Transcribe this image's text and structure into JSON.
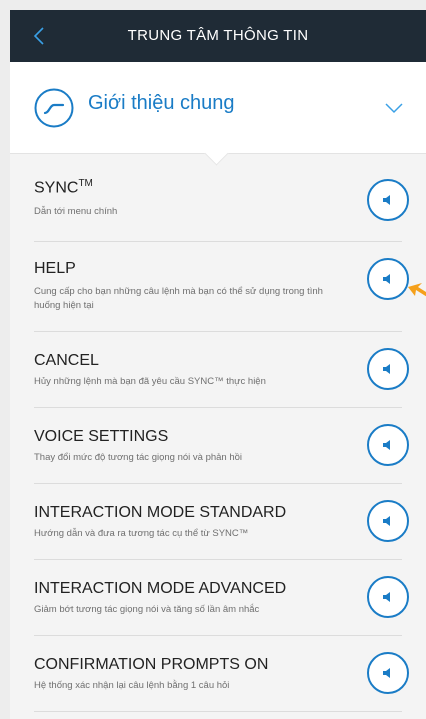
{
  "header": {
    "back_icon": "chevron-left-icon",
    "title": "TRUNG TÂM THÔNG TIN"
  },
  "selector": {
    "icon": "sync-curve-icon",
    "label": "Giới thiệu chung",
    "chevron_icon": "chevron-down-icon"
  },
  "commands": [
    {
      "title": "SYNC",
      "title_sup": "TM",
      "description": "Dẫn tới menu chính",
      "button_icon": "speaker-icon"
    },
    {
      "title": "HELP",
      "description": "Cung cấp cho bạn những câu lệnh mà bạn có thể sử dụng trong tình huống hiện tại",
      "button_icon": "speaker-icon"
    },
    {
      "title": "CANCEL",
      "description": "Hủy những lệnh mà bạn đã yêu cầu SYNC™ thực hiện",
      "button_icon": "speaker-icon"
    },
    {
      "title": "VOICE SETTINGS",
      "description": "Thay đổi mức độ tương tác giọng nói và phản hồi",
      "button_icon": "speaker-icon"
    },
    {
      "title": "INTERACTION MODE STANDARD",
      "description": "Hướng dẫn và đưa ra tương tác cụ thể từ SYNC™",
      "button_icon": "speaker-icon"
    },
    {
      "title": "INTERACTION MODE ADVANCED",
      "description": "Giảm bớt tương tác giọng nói và tăng số lần âm nhắc",
      "button_icon": "speaker-icon"
    },
    {
      "title": "CONFIRMATION PROMPTS ON",
      "description": "Hệ thống xác nhận lại câu lệnh bằng 1 câu hỏi",
      "button_icon": "speaker-icon"
    }
  ],
  "colors": {
    "header_bg": "#1f2b36",
    "accent": "#1a7cc6",
    "pointer_arrow": "#f5a01a"
  }
}
